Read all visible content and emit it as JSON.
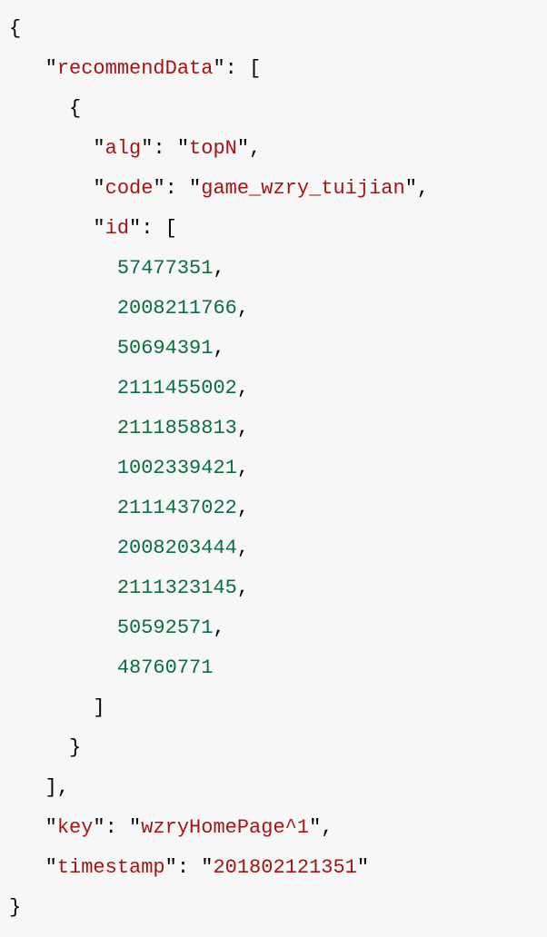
{
  "json": {
    "braceOpen": "{",
    "braceClose": "}",
    "bracketOpen": "[",
    "bracketClose": "]",
    "colon": ":",
    "comma": ",",
    "quote": "\"",
    "keys": {
      "recommendData": "recommendData",
      "alg": "alg",
      "code": "code",
      "id": "id",
      "key": "key",
      "timestamp": "timestamp"
    },
    "values": {
      "alg": "topN",
      "code": "game_wzry_tuijian",
      "key": "wzryHomePage^1",
      "timestamp": "201802121351"
    },
    "ids": [
      "57477351",
      "2008211766",
      "50694391",
      "2111455002",
      "2111858813",
      "1002339421",
      "2111437022",
      "2008203444",
      "2111323145",
      "50592571",
      "48760771"
    ]
  }
}
